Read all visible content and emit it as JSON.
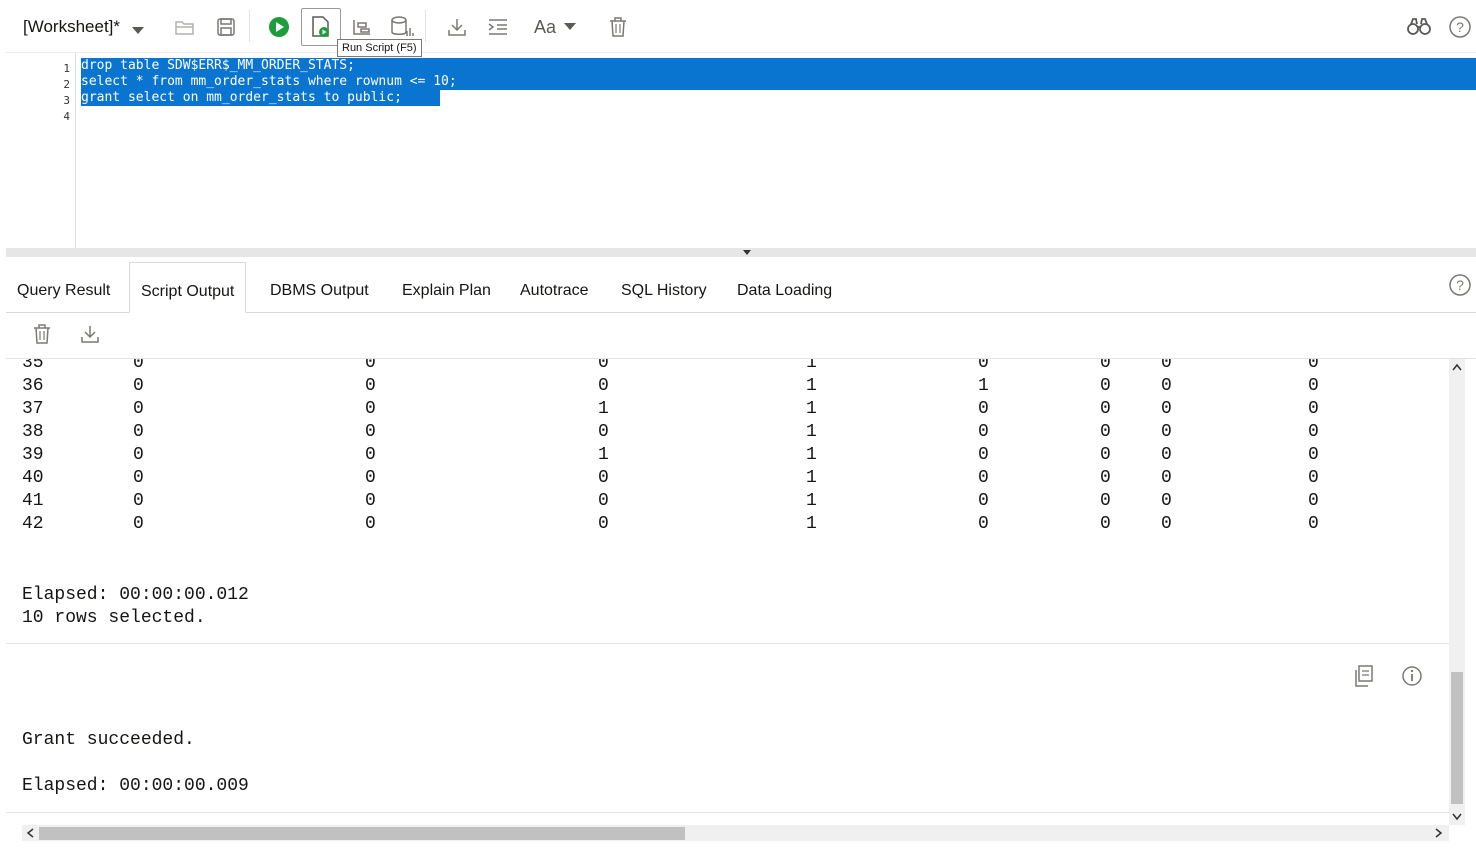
{
  "toolbar": {
    "worksheet_title": "[Worksheet]*",
    "tooltip": "Run Script (F5)",
    "font_label": "Aa"
  },
  "editor": {
    "line_numbers": [
      "1",
      "2",
      "3",
      "4"
    ],
    "lines": [
      "drop table SDW$ERR$_MM_ORDER_STATS;",
      "select * from mm_order_stats where rownum <= 10;",
      "grant select on mm_order_stats to public;",
      ""
    ]
  },
  "tabs": [
    {
      "label": "Query Result",
      "active": false
    },
    {
      "label": "Script Output",
      "active": true
    },
    {
      "label": "DBMS Output",
      "active": false
    },
    {
      "label": "Explain Plan",
      "active": false
    },
    {
      "label": "Autotrace",
      "active": false
    },
    {
      "label": "SQL History",
      "active": false
    },
    {
      "label": "Data Loading",
      "active": false
    }
  ],
  "output": {
    "rows": [
      [
        "35",
        "0",
        "0",
        "0",
        "1",
        "0",
        "0",
        "0",
        "0"
      ],
      [
        "36",
        "0",
        "0",
        "0",
        "1",
        "1",
        "0",
        "0",
        "0"
      ],
      [
        "37",
        "0",
        "0",
        "1",
        "1",
        "0",
        "0",
        "0",
        "0"
      ],
      [
        "38",
        "0",
        "0",
        "0",
        "1",
        "0",
        "0",
        "0",
        "0"
      ],
      [
        "39",
        "0",
        "0",
        "1",
        "1",
        "0",
        "0",
        "0",
        "0"
      ],
      [
        "40",
        "0",
        "0",
        "0",
        "1",
        "0",
        "0",
        "0",
        "0"
      ],
      [
        "41",
        "0",
        "0",
        "0",
        "1",
        "0",
        "0",
        "0",
        "0"
      ],
      [
        "42",
        "0",
        "0",
        "0",
        "1",
        "0",
        "0",
        "0",
        "0"
      ]
    ],
    "elapsed_1": "Elapsed: 00:00:00.012",
    "rows_selected": "10 rows selected.",
    "grant_msg": "Grant succeeded.",
    "elapsed_2": "Elapsed: 00:00:00.009"
  },
  "colors": {
    "selection": "#0a74d1",
    "run_green": "#1e9e3a"
  }
}
